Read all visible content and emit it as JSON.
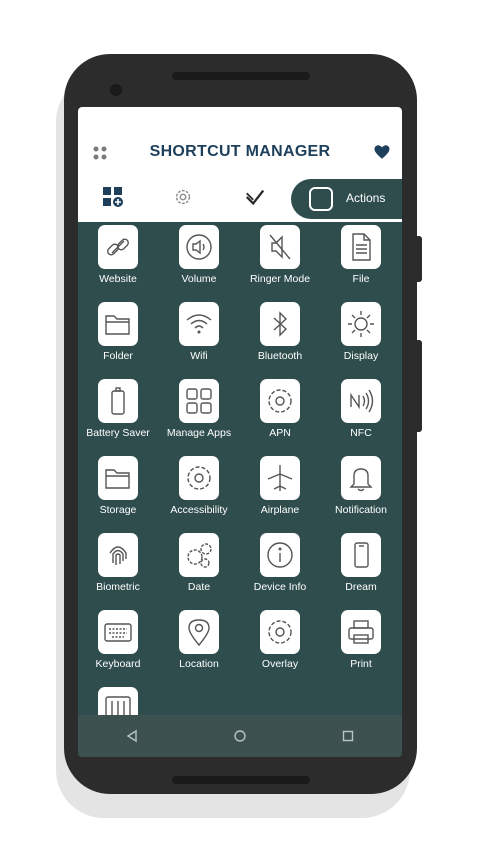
{
  "app": {
    "title": "SHORTCUT MANAGER",
    "accent_color": "#2f4d4d",
    "title_color": "#1d3f5b"
  },
  "header": {
    "menu_icon": "dots-grid-icon",
    "favorite_icon": "heart-icon"
  },
  "tabs": [
    {
      "icon": "app-grid-icon"
    },
    {
      "icon": "settings-gear-icon"
    },
    {
      "icon": "layered-check-icon"
    },
    {
      "icon": "actions-icon",
      "label": "Actions",
      "selected": true
    }
  ],
  "shortcuts": [
    {
      "label": "Website",
      "icon": "link-icon"
    },
    {
      "label": "Volume",
      "icon": "speaker-icon"
    },
    {
      "label": "Ringer Mode",
      "icon": "speaker-muted-icon"
    },
    {
      "label": "File",
      "icon": "document-icon"
    },
    {
      "label": "Folder",
      "icon": "folder-icon"
    },
    {
      "label": "Wifi",
      "icon": "wifi-icon"
    },
    {
      "label": "Bluetooth",
      "icon": "bluetooth-icon"
    },
    {
      "label": "Display",
      "icon": "sun-icon"
    },
    {
      "label": "Battery Saver",
      "icon": "battery-icon"
    },
    {
      "label": "Manage Apps",
      "icon": "four-squares-icon"
    },
    {
      "label": "APN",
      "icon": "gear-icon"
    },
    {
      "label": "NFC",
      "icon": "nfc-icon"
    },
    {
      "label": "Storage",
      "icon": "storage-folder-icon"
    },
    {
      "label": "Accessibility",
      "icon": "accessibility-gear-icon"
    },
    {
      "label": "Airplane",
      "icon": "airplane-icon"
    },
    {
      "label": "Notification",
      "icon": "bell-icon"
    },
    {
      "label": "Biometric",
      "icon": "fingerprint-icon"
    },
    {
      "label": "Date",
      "icon": "gears-icon"
    },
    {
      "label": "Device Info",
      "icon": "info-icon"
    },
    {
      "label": "Dream",
      "icon": "phone-icon"
    },
    {
      "label": "Keyboard",
      "icon": "keyboard-icon"
    },
    {
      "label": "Location",
      "icon": "location-pin-icon"
    },
    {
      "label": "Overlay",
      "icon": "overlay-gear-icon"
    },
    {
      "label": "Print",
      "icon": "printer-icon"
    },
    {
      "label": "",
      "icon": "sliders-icon"
    }
  ],
  "navbar": {
    "back_icon": "back-triangle-icon",
    "home_icon": "home-circle-icon",
    "recents_icon": "recents-square-icon"
  }
}
